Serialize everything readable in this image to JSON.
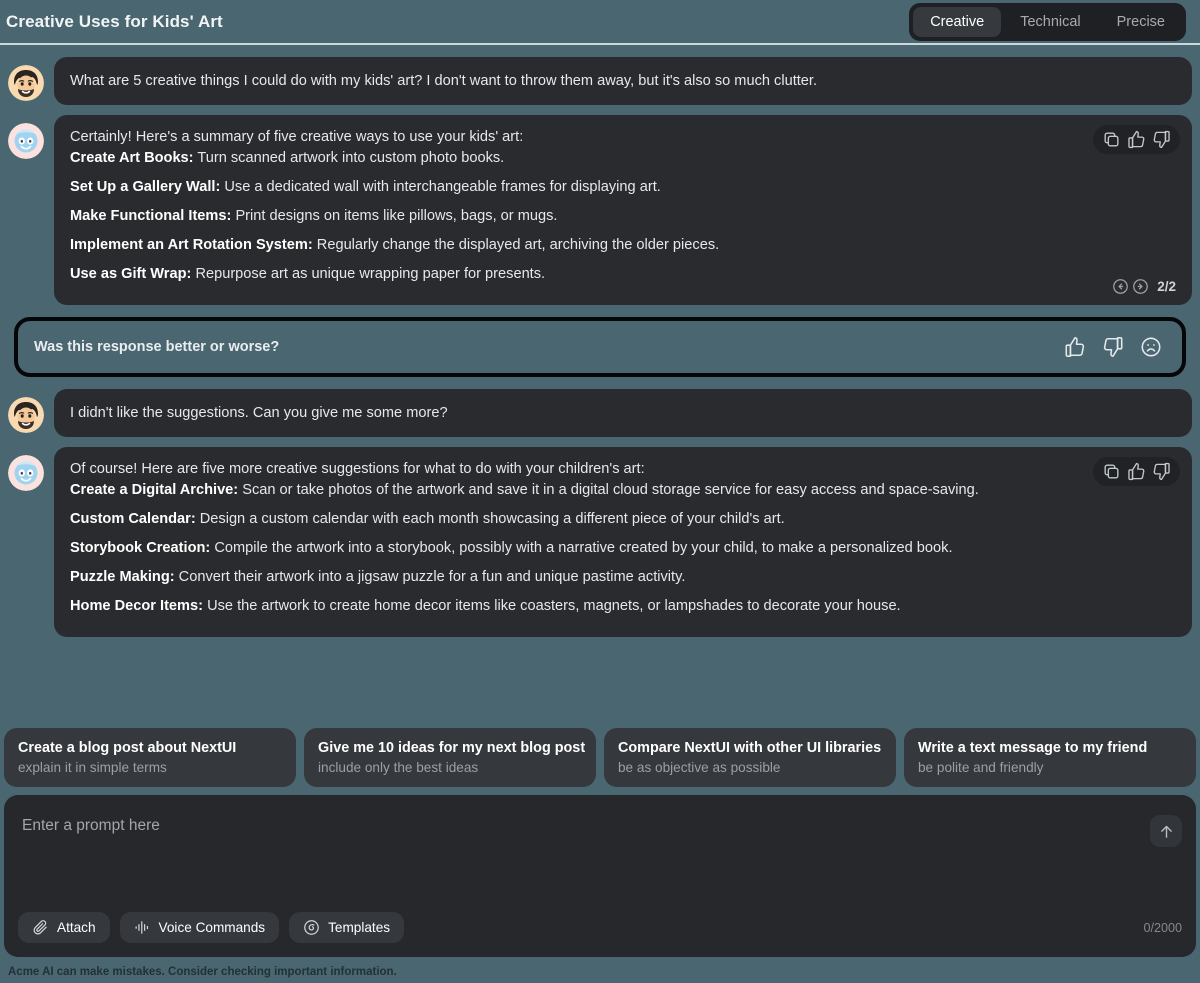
{
  "header": {
    "title": "Creative Uses for Kids' Art",
    "tabs": [
      {
        "label": "Creative",
        "active": true
      },
      {
        "label": "Technical",
        "active": false
      },
      {
        "label": "Precise",
        "active": false
      }
    ]
  },
  "conversation": {
    "user1": "What are 5 creative things I could do with my kids' art? I don't want to throw them away, but it's also so much clutter.",
    "assistant1": {
      "intro": "Certainly! Here's a summary of five creative ways to use your kids' art:",
      "items": [
        {
          "term": "Create Art Books:",
          "text": "Turn scanned artwork into custom photo books."
        },
        {
          "term": "Set Up a Gallery Wall:",
          "text": "Use a dedicated wall with interchangeable frames for displaying art."
        },
        {
          "term": "Make Functional Items:",
          "text": "Print designs on items like pillows, bags, or mugs."
        },
        {
          "term": "Implement an Art Rotation System:",
          "text": "Regularly change the displayed art, archiving the older pieces."
        },
        {
          "term": "Use as Gift Wrap:",
          "text": "Repurpose art as unique wrapping paper for presents."
        }
      ],
      "pager": "2/2"
    },
    "feedback": {
      "question": "Was this response better or worse?"
    },
    "user2": "I didn't like the suggestions. Can you give me some more?",
    "assistant2": {
      "intro": "Of course! Here are five more creative suggestions for what to do with your children's art:",
      "items": [
        {
          "term": "Create a Digital Archive:",
          "text": "Scan or take photos of the artwork and save it in a digital cloud storage service for easy access and space-saving."
        },
        {
          "term": "Custom Calendar:",
          "text": "Design a custom calendar with each month showcasing a different piece of your child's art."
        },
        {
          "term": "Storybook Creation:",
          "text": "Compile the artwork into a storybook, possibly with a narrative created by your child, to make a personalized book."
        },
        {
          "term": "Puzzle Making:",
          "text": "Convert their artwork into a jigsaw puzzle for a fun and unique pastime activity."
        },
        {
          "term": "Home Decor Items:",
          "text": "Use the artwork to create home decor items like coasters, magnets, or lampshades to decorate your house."
        }
      ]
    }
  },
  "suggestions": [
    {
      "title": "Create a blog post about NextUI",
      "subtitle": "explain it in simple terms"
    },
    {
      "title": "Give me 10 ideas for my next blog post",
      "subtitle": "include only the best ideas"
    },
    {
      "title": "Compare NextUI with other UI libraries",
      "subtitle": "be as objective as possible"
    },
    {
      "title": "Write a text message to my friend",
      "subtitle": "be polite and friendly"
    }
  ],
  "composer": {
    "placeholder": "Enter a prompt here",
    "counter": "0/2000",
    "tools": [
      {
        "label": "Attach",
        "icon": "paperclip-icon"
      },
      {
        "label": "Voice Commands",
        "icon": "waveform-icon"
      },
      {
        "label": "Templates",
        "icon": "templates-icon"
      }
    ],
    "send_icon": "arrow-up-icon"
  },
  "footer": {
    "disclaimer": "Acme AI can make mistakes. Consider checking important information."
  },
  "colors": {
    "page_background": "#4a6670",
    "bubble": "#292b2e",
    "tab_active": "#363a3e",
    "accent_border": "#050607"
  }
}
